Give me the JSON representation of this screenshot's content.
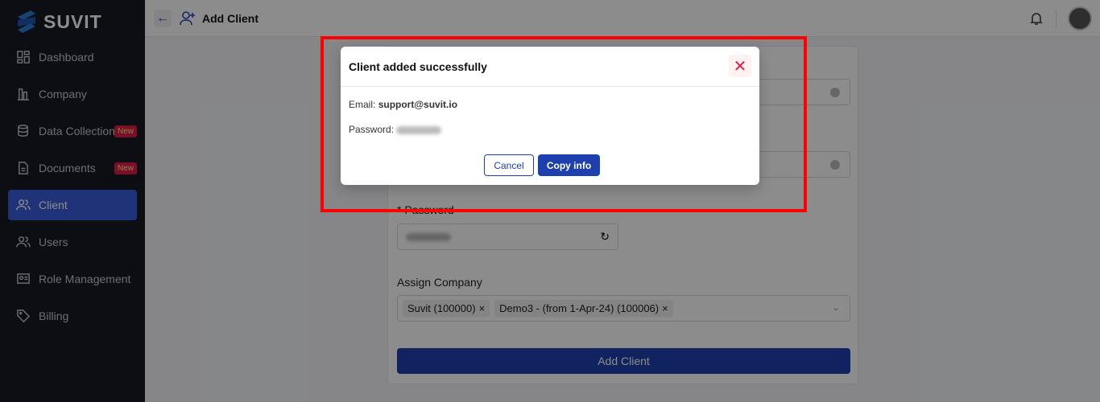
{
  "brand": {
    "name": "SUVIT"
  },
  "sidebar": {
    "items": [
      {
        "label": "Dashboard",
        "icon": "dashboard-icon"
      },
      {
        "label": "Company",
        "icon": "building-icon"
      },
      {
        "label": "Data Collection",
        "icon": "database-icon",
        "badge": "New"
      },
      {
        "label": "Documents",
        "icon": "document-icon",
        "badge": "New"
      },
      {
        "label": "Client",
        "icon": "users-icon",
        "active": true
      },
      {
        "label": "Users",
        "icon": "users-icon"
      },
      {
        "label": "Role Management",
        "icon": "id-card-icon"
      },
      {
        "label": "Billing",
        "icon": "tag-icon"
      }
    ]
  },
  "header": {
    "title": "Add Client"
  },
  "form": {
    "password_label": "* Password",
    "assign_label": "Assign Company",
    "tags": [
      "Suvit (100000)",
      "Demo3 - (from 1-Apr-24) (100006)"
    ],
    "submit": "Add Client"
  },
  "modal": {
    "title": "Client added successfully",
    "email_label": "Email:",
    "email": "support@suvit.io",
    "password_label": "Password:",
    "cancel": "Cancel",
    "copy": "Copy info"
  },
  "colors": {
    "primary": "#1e40af",
    "highlight": "#ff0000",
    "badge": "#e11d48"
  }
}
